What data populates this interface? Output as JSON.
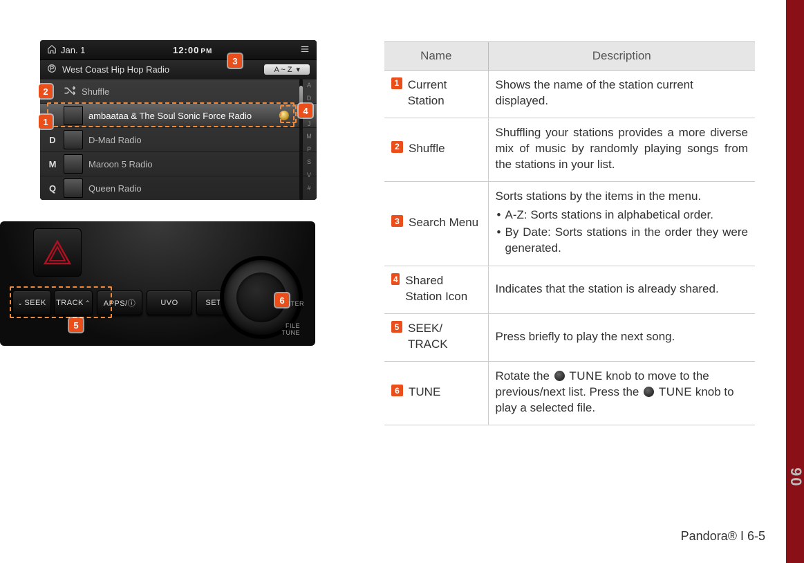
{
  "status_bar": {
    "date": "Jan. 1",
    "clock": "12:00",
    "ampm": "PM"
  },
  "station": {
    "name": "West Coast Hip Hop Radio"
  },
  "sort_pill": {
    "label": "A ~ Z"
  },
  "list": [
    {
      "letter": "",
      "title": "Shuffle",
      "shuffle": true
    },
    {
      "letter": "",
      "title": "ambaataa & The Soul Sonic Force Radio",
      "selected": true,
      "shared": true
    },
    {
      "letter": "D",
      "title": "D-Mad Radio"
    },
    {
      "letter": "M",
      "title": "Maroon 5 Radio"
    },
    {
      "letter": "Q",
      "title": "Queen Radio"
    }
  ],
  "alpha": [
    "A",
    "D",
    "G",
    "J",
    "M",
    "P",
    "S",
    "V",
    "#"
  ],
  "panel": {
    "buttons": {
      "seek": "SEEK",
      "track": "TRACK",
      "apps": "APPS/ⓘ",
      "uvo": "UVO",
      "setup": "SETUP"
    },
    "knob": {
      "enter": "ENTER",
      "file": "FILE",
      "tune": "TUNE"
    }
  },
  "table": {
    "head": {
      "name": "Name",
      "desc": "Description"
    },
    "rows": [
      {
        "num": "1",
        "name": "Current Station",
        "desc": "Shows the name of the station current displayed."
      },
      {
        "num": "2",
        "name": "Shuffle",
        "desc": "Shuffling your stations provides a more diverse mix of music by randomly playing songs from the stations in your list."
      },
      {
        "num": "3",
        "name": "Search Menu",
        "desc": "Sorts stations by the items in the menu.",
        "bullets": [
          "A-Z: Sorts stations in alphabetical order.",
          "By Date: Sorts stations in the order they were generated."
        ]
      },
      {
        "num": "4",
        "name": "Shared Station Icon",
        "desc": "Indicates that the station is already shared."
      },
      {
        "num": "5",
        "name": "SEEK/ TRACK",
        "desc": "Press briefly to play the next song."
      },
      {
        "num": "6",
        "name": "TUNE",
        "desc_pre": "Rotate the ",
        "desc_mid": " knob to move to the previous/next list. Press the ",
        "desc_post": " knob to play a selected file.",
        "tune_label": "TUNE"
      }
    ]
  },
  "footer": {
    "text": "Pandora® I 6-5"
  },
  "section_tab": "06",
  "markers": {
    "m1": "1",
    "m2": "2",
    "m3": "3",
    "m4": "4",
    "m5": "5",
    "m6": "6"
  }
}
